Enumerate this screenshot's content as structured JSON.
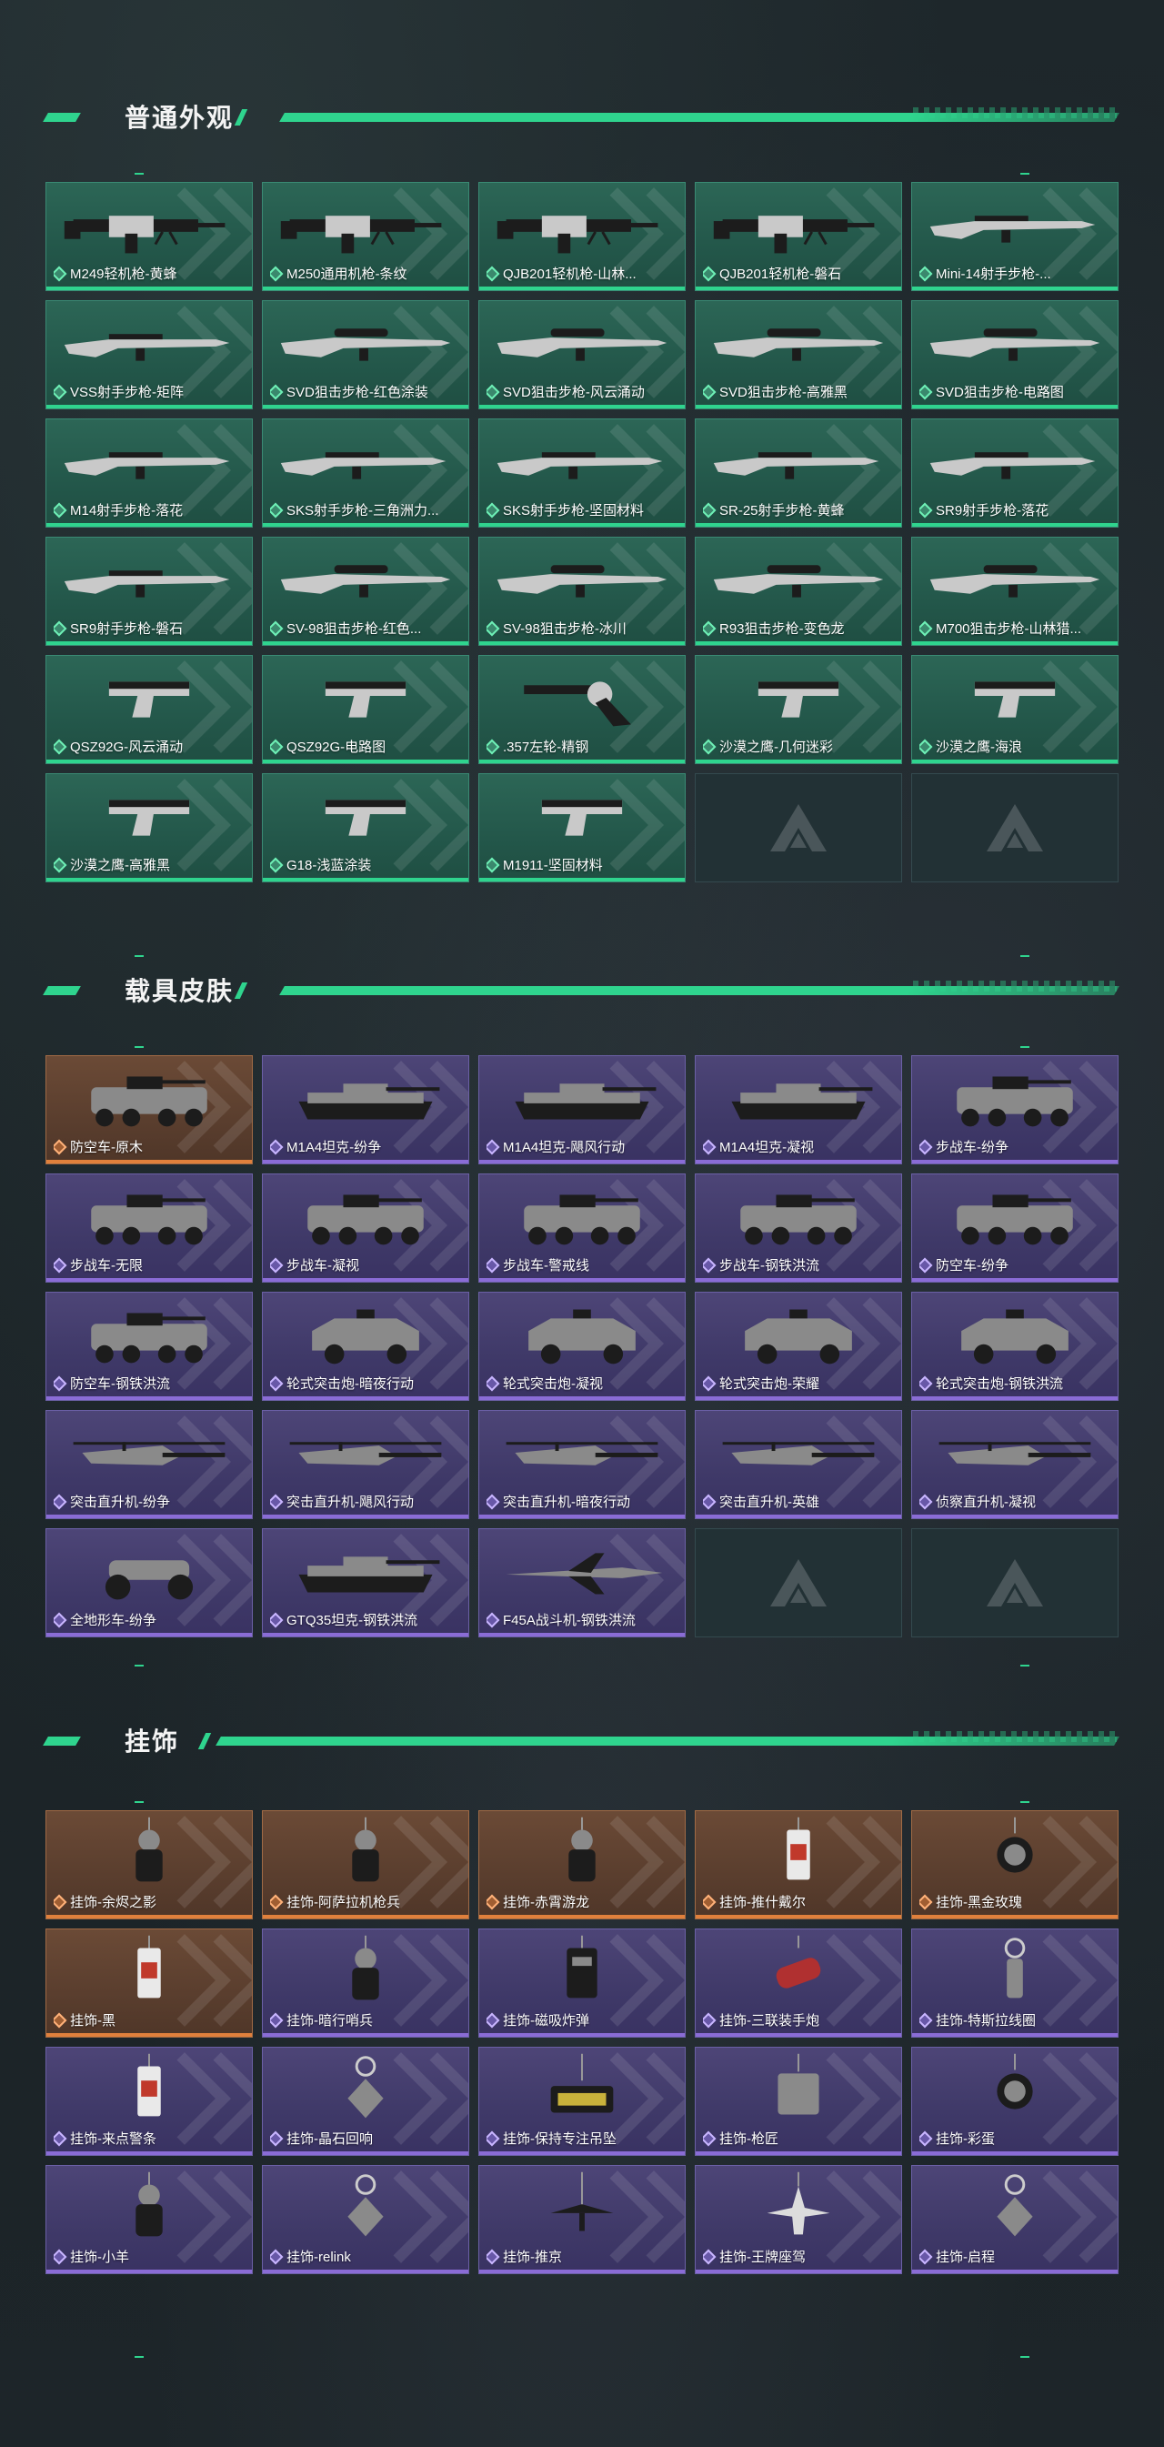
{
  "sections": [
    {
      "title": "普通外观",
      "items": [
        {
          "label": "M249轻机枪-黄蜂",
          "rarity": "green",
          "icon": "lmg-icon"
        },
        {
          "label": "M250通用机枪-条纹",
          "rarity": "green",
          "icon": "lmg-icon"
        },
        {
          "label": "QJB201轻机枪-山林...",
          "rarity": "green",
          "icon": "lmg-icon"
        },
        {
          "label": "QJB201轻机枪-磐石",
          "rarity": "green",
          "icon": "lmg-icon"
        },
        {
          "label": "Mini-14射手步枪-...",
          "rarity": "green",
          "icon": "rifle-icon"
        },
        {
          "label": "VSS射手步枪-矩阵",
          "rarity": "green",
          "icon": "rifle-icon"
        },
        {
          "label": "SVD狙击步枪-红色涂装",
          "rarity": "green",
          "icon": "sniper-icon"
        },
        {
          "label": "SVD狙击步枪-风云涌动",
          "rarity": "green",
          "icon": "sniper-icon"
        },
        {
          "label": "SVD狙击步枪-高雅黑",
          "rarity": "green",
          "icon": "sniper-icon"
        },
        {
          "label": "SVD狙击步枪-电路图",
          "rarity": "green",
          "icon": "sniper-icon"
        },
        {
          "label": "M14射手步枪-落花",
          "rarity": "green",
          "icon": "rifle-icon"
        },
        {
          "label": "SKS射手步枪-三角洲力...",
          "rarity": "green",
          "icon": "rifle-icon"
        },
        {
          "label": "SKS射手步枪-坚固材料",
          "rarity": "green",
          "icon": "rifle-icon"
        },
        {
          "label": "SR-25射手步枪-黄蜂",
          "rarity": "green",
          "icon": "rifle-icon"
        },
        {
          "label": "SR9射手步枪-落花",
          "rarity": "green",
          "icon": "rifle-icon"
        },
        {
          "label": "SR9射手步枪-磐石",
          "rarity": "green",
          "icon": "rifle-icon"
        },
        {
          "label": "SV-98狙击步枪-红色...",
          "rarity": "green",
          "icon": "sniper-icon"
        },
        {
          "label": "SV-98狙击步枪-冰川",
          "rarity": "green",
          "icon": "sniper-icon"
        },
        {
          "label": "R93狙击步枪-变色龙",
          "rarity": "green",
          "icon": "sniper-icon"
        },
        {
          "label": "M700狙击步枪-山林猎...",
          "rarity": "green",
          "icon": "sniper-icon"
        },
        {
          "label": "QSZ92G-风云涌动",
          "rarity": "green",
          "icon": "pistol-icon"
        },
        {
          "label": "QSZ92G-电路图",
          "rarity": "green",
          "icon": "pistol-icon"
        },
        {
          "label": ".357左轮-精钢",
          "rarity": "green",
          "icon": "revolver-icon"
        },
        {
          "label": "沙漠之鹰-几何迷彩",
          "rarity": "green",
          "icon": "pistol-icon"
        },
        {
          "label": "沙漠之鹰-海浪",
          "rarity": "green",
          "icon": "pistol-icon"
        },
        {
          "label": "沙漠之鹰-高雅黑",
          "rarity": "green",
          "icon": "pistol-icon"
        },
        {
          "label": "G18-浅蓝涂装",
          "rarity": "green",
          "icon": "pistol-icon"
        },
        {
          "label": "M1911-坚固材料",
          "rarity": "green",
          "icon": "pistol-icon"
        },
        {
          "label": "",
          "rarity": "empty",
          "icon": "delta-logo-icon"
        },
        {
          "label": "",
          "rarity": "empty",
          "icon": "delta-logo-icon"
        }
      ]
    },
    {
      "title": "载具皮肤",
      "items": [
        {
          "label": "防空车-原木",
          "rarity": "orange",
          "icon": "apc-icon"
        },
        {
          "label": "M1A4坦克-纷争",
          "rarity": "purple",
          "icon": "tank-icon"
        },
        {
          "label": "M1A4坦克-飓风行动",
          "rarity": "purple",
          "icon": "tank-icon"
        },
        {
          "label": "M1A4坦克-凝视",
          "rarity": "purple",
          "icon": "tank-icon"
        },
        {
          "label": "步战车-纷争",
          "rarity": "purple",
          "icon": "apc-icon"
        },
        {
          "label": "步战车-无限",
          "rarity": "purple",
          "icon": "apc-icon"
        },
        {
          "label": "步战车-凝视",
          "rarity": "purple",
          "icon": "apc-icon"
        },
        {
          "label": "步战车-警戒线",
          "rarity": "purple",
          "icon": "apc-icon"
        },
        {
          "label": "步战车-钢铁洪流",
          "rarity": "purple",
          "icon": "apc-icon"
        },
        {
          "label": "防空车-纷争",
          "rarity": "purple",
          "icon": "apc-icon"
        },
        {
          "label": "防空车-钢铁洪流",
          "rarity": "purple",
          "icon": "apc-icon"
        },
        {
          "label": "轮式突击炮-暗夜行动",
          "rarity": "purple",
          "icon": "armored-car-icon"
        },
        {
          "label": "轮式突击炮-凝视",
          "rarity": "purple",
          "icon": "armored-car-icon"
        },
        {
          "label": "轮式突击炮-荣耀",
          "rarity": "purple",
          "icon": "armored-car-icon"
        },
        {
          "label": "轮式突击炮-钢铁洪流",
          "rarity": "purple",
          "icon": "armored-car-icon"
        },
        {
          "label": "突击直升机-纷争",
          "rarity": "purple",
          "icon": "helicopter-icon"
        },
        {
          "label": "突击直升机-飓风行动",
          "rarity": "purple",
          "icon": "helicopter-icon"
        },
        {
          "label": "突击直升机-暗夜行动",
          "rarity": "purple",
          "icon": "helicopter-icon"
        },
        {
          "label": "突击直升机-英雄",
          "rarity": "purple",
          "icon": "helicopter-icon"
        },
        {
          "label": "侦察直升机-凝视",
          "rarity": "purple",
          "icon": "helicopter-icon"
        },
        {
          "label": "全地形车-纷争",
          "rarity": "purple",
          "icon": "atv-icon"
        },
        {
          "label": "GTQ35坦克-钢铁洪流",
          "rarity": "purple",
          "icon": "tank-icon"
        },
        {
          "label": "F45A战斗机-钢铁洪流",
          "rarity": "purple",
          "icon": "jet-icon"
        },
        {
          "label": "",
          "rarity": "empty",
          "icon": "delta-logo-icon"
        },
        {
          "label": "",
          "rarity": "empty",
          "icon": "delta-logo-icon"
        }
      ]
    },
    {
      "title": "挂饰",
      "items": [
        {
          "label": "挂饰-余烬之影",
          "rarity": "orange",
          "icon": "charm-figure-icon"
        },
        {
          "label": "挂饰-阿萨拉机枪兵",
          "rarity": "orange",
          "icon": "charm-figure-icon"
        },
        {
          "label": "挂饰-赤霄游龙",
          "rarity": "orange",
          "icon": "charm-figure-icon"
        },
        {
          "label": "挂饰-推什戴尔",
          "rarity": "orange",
          "icon": "charm-tag-icon"
        },
        {
          "label": "挂饰-黑金玫瑰",
          "rarity": "orange",
          "icon": "charm-medal-icon"
        },
        {
          "label": "挂饰-黑",
          "rarity": "orange",
          "icon": "charm-tag-icon"
        },
        {
          "label": "挂饰-暗行哨兵",
          "rarity": "purple",
          "icon": "charm-figure-icon"
        },
        {
          "label": "挂饰-磁吸炸弹",
          "rarity": "purple",
          "icon": "charm-bomb-icon"
        },
        {
          "label": "挂饰-三联装手炮",
          "rarity": "purple",
          "icon": "charm-tube-icon"
        },
        {
          "label": "挂饰-特斯拉线圈",
          "rarity": "purple",
          "icon": "charm-coil-icon"
        },
        {
          "label": "挂饰-来点警条",
          "rarity": "purple",
          "icon": "charm-tag-icon"
        },
        {
          "label": "挂饰-晶石回响",
          "rarity": "purple",
          "icon": "charm-ring-icon"
        },
        {
          "label": "挂饰-保持专注吊坠",
          "rarity": "purple",
          "icon": "charm-plate-icon"
        },
        {
          "label": "挂饰-枪匠",
          "rarity": "purple",
          "icon": "charm-box-icon"
        },
        {
          "label": "挂饰-彩蛋",
          "rarity": "purple",
          "icon": "charm-medal-icon"
        },
        {
          "label": "挂饰-小羊",
          "rarity": "purple",
          "icon": "charm-figure-icon"
        },
        {
          "label": "挂饰-relink",
          "rarity": "purple",
          "icon": "charm-ring-icon"
        },
        {
          "label": "挂饰-推京",
          "rarity": "purple",
          "icon": "charm-hanger-icon"
        },
        {
          "label": "挂饰-王牌座驾",
          "rarity": "purple",
          "icon": "charm-plane-icon"
        },
        {
          "label": "挂饰-启程",
          "rarity": "purple",
          "icon": "charm-ring-icon"
        }
      ]
    }
  ],
  "colors": {
    "accent": "#2fd48e",
    "green_card": "#2c6656",
    "purple_card": "#4d4577",
    "orange_card": "#6b4a36",
    "empty_card": "#223135",
    "background": "#1b2327"
  }
}
